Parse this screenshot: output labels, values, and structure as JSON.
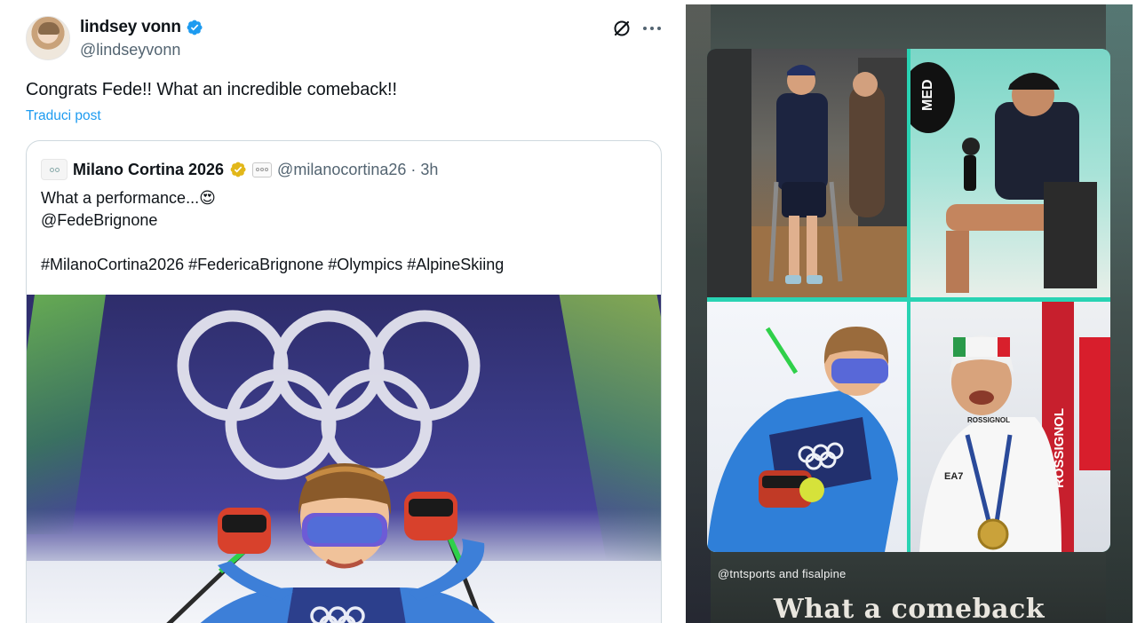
{
  "post": {
    "author_name": "lindsey vonn",
    "author_handle": "@lindseyvonn",
    "text": "Congrats Fede!! What an incredible comeback!!",
    "translate_label": "Traduci post",
    "accent_color": "#1d9bf0"
  },
  "quote": {
    "name": "Milano Cortina 2026",
    "handle_time": "@milanocortina26 · 3h",
    "text": "What a performance...😍\n@FedeBrignone\n\n#MilanoCortina2026 #FedericaBrignone #Olympics #AlpineSkiing",
    "media_description_icon": "olympic-rings-photo"
  },
  "story": {
    "credit": "@tntsports and fisalpine",
    "headline": "What a comeback",
    "accent_color": "#29d3b3",
    "cell_texts": {
      "med_sign": "MED",
      "bib_text": "ROSSIGNOL",
      "ski_brand": "ROSSIGNOL",
      "jacket_brand": "EA7"
    }
  }
}
